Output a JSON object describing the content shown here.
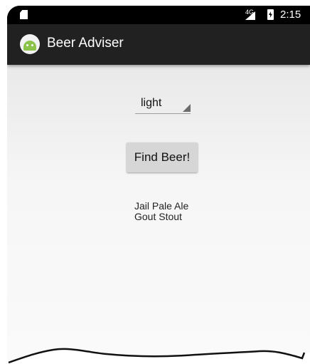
{
  "status_bar": {
    "network": "4G",
    "time": "2:15",
    "icons": [
      "sd-card-icon",
      "signal-icon",
      "battery-charging-icon"
    ]
  },
  "app_bar": {
    "icon": "android-icon",
    "title": "Beer Adviser"
  },
  "main": {
    "color_spinner": {
      "selected": "light"
    },
    "find_button_label": "Find Beer!",
    "brands": [
      "Jail Pale Ale",
      "Gout Stout"
    ]
  }
}
